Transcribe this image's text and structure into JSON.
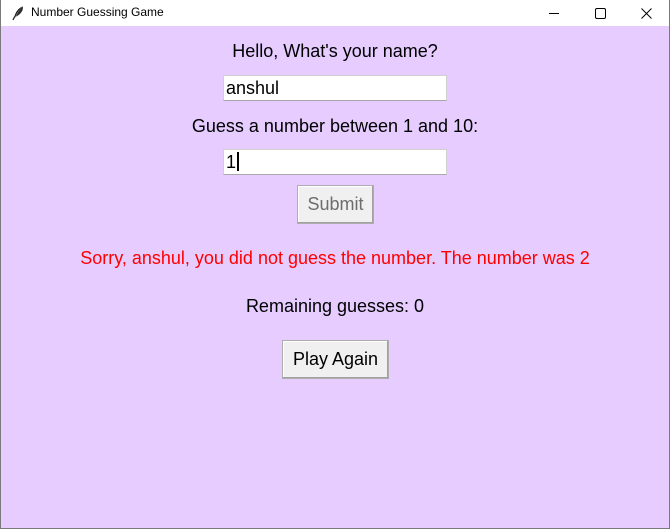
{
  "window": {
    "title": "Number Guessing Game",
    "icon": "feather-icon",
    "controls": [
      "minimize-icon",
      "maximize-icon",
      "close-icon"
    ],
    "background": "#e6ccff"
  },
  "form": {
    "name_prompt": "Hello, What's your name?",
    "name_value": "anshul",
    "guess_prompt": "Guess a number between 1 and 10:",
    "guess_value": "1",
    "submit_label": "Submit",
    "submit_enabled": false
  },
  "result": {
    "message": "Sorry, anshul, you did not guess the number. The number was 2",
    "message_color": "#ff0000",
    "remaining": "Remaining guesses: 0"
  },
  "actions": {
    "play_again_label": "Play Again"
  }
}
